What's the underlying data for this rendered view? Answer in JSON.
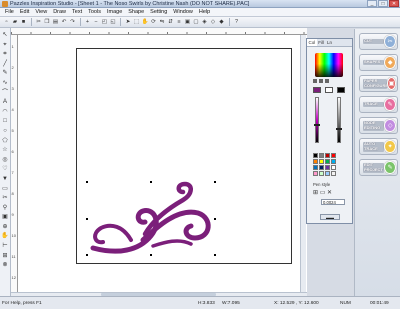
{
  "window": {
    "title": "Pazzles Inspiration Studio - [Sheet 1 - The Noso Swirls by Christine Nash (DO NOT SHARE).PAC]",
    "buttons": [
      "_",
      "□",
      "✕"
    ]
  },
  "menu": [
    "File",
    "Edit",
    "View",
    "Draw",
    "Text",
    "Tools",
    "Image",
    "Shape",
    "Setting",
    "Window",
    "Help"
  ],
  "toolbar_icons": [
    "new-file-icon",
    "open-icon",
    "save-icon",
    "cut-icon",
    "copy-icon",
    "paste-icon",
    "undo-icon",
    "redo-icon",
    "zoom-in-icon",
    "zoom-out-icon",
    "zoom-fit-icon",
    "zoom-page-icon",
    "select-icon",
    "node-icon",
    "hand-icon",
    "rotate-icon",
    "mirror-icon",
    "flip-icon",
    "align-icon",
    "group-icon",
    "ungroup-icon",
    "weld-icon",
    "trim-icon",
    "intersect-icon"
  ],
  "ruler_left": [
    "1",
    "2",
    "3",
    "4",
    "5",
    "6",
    "7",
    "8",
    "9",
    "10",
    "11",
    "12"
  ],
  "palette": {
    "tabs": [
      "Col",
      "Fill",
      "Ln"
    ],
    "pen_style_label": "Pen style",
    "width_value": "0.0024",
    "colors": [
      "#000000",
      "#7f7f7f",
      "#c00000",
      "#ff0000",
      "#ff7f00",
      "#ffff00",
      "#00b050",
      "#00b0f0",
      "#0070c0",
      "#002060",
      "#7030a0",
      "#ffffff",
      "#ff99cc",
      "#ccffcc",
      "#99ccff",
      "#f2f2f2"
    ],
    "slider_fill_color": "#c000c0"
  },
  "side_panel": [
    {
      "label": "CUT",
      "color": "#8fb0d8"
    },
    {
      "label": "SHAPES",
      "color": "#f0a95a"
    },
    {
      "label": "PAPER CONFIGURE",
      "color": "#e46a6a"
    },
    {
      "label": "TRACE",
      "color": "#e86fa0"
    },
    {
      "label": "NODE EDITING",
      "color": "#c28de0"
    },
    {
      "label": "AUTO TRACE",
      "color": "#f2c84a"
    },
    {
      "label": "EDIT PROJECT",
      "color": "#7cc46a"
    }
  ],
  "shape": {
    "fill_color": "#7b1f7a"
  },
  "status": {
    "help": "For Help, press F1",
    "height": "H:3.833",
    "width": "W:7.095",
    "coords": "X: 12.529 , Y: 12.600",
    "num": "NUM",
    "time": "00:01:49"
  }
}
